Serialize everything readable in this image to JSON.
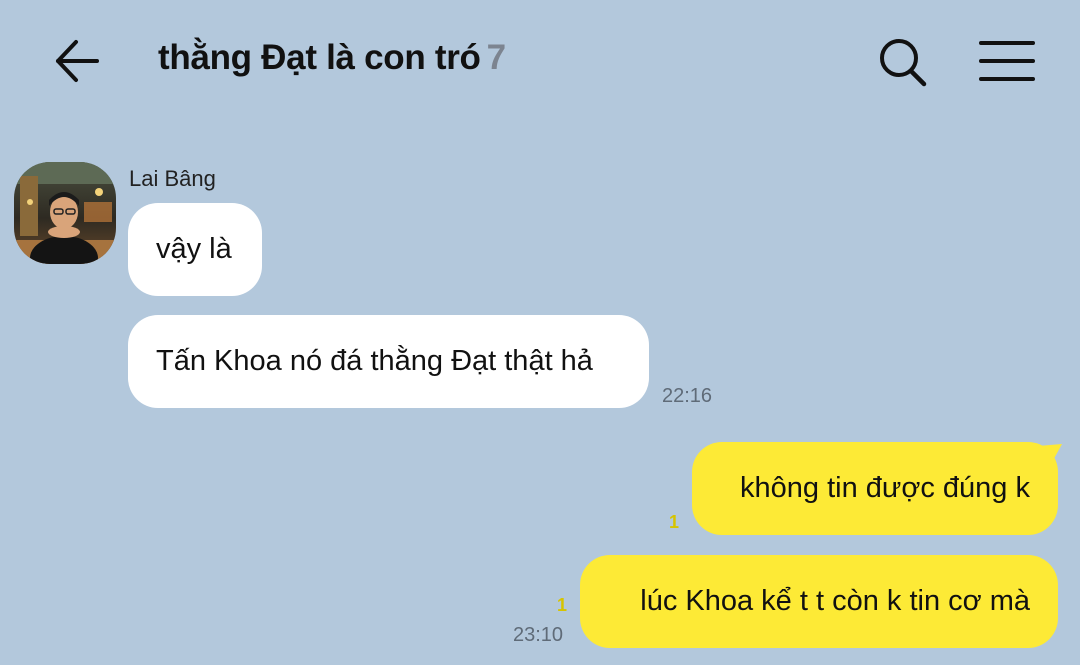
{
  "header": {
    "title": "thằng Đạt là con tró",
    "member_count": "7",
    "icons": {
      "back": "arrow-left-icon",
      "search": "search-icon",
      "menu": "hamburger-menu-icon"
    }
  },
  "colors": {
    "background": "#b3c8dc",
    "incoming_bubble": "#ffffff",
    "outgoing_bubble": "#fdea36",
    "unread_count": "#d6c400",
    "timestamp": "#5f6b78"
  },
  "messages": {
    "incoming": {
      "sender": "Lai Bâng",
      "items": [
        {
          "text": "vậy là"
        },
        {
          "text": "Tấn Khoa nó đá thằng Đạt thật hả",
          "time": "22:16"
        }
      ]
    },
    "outgoing": {
      "items": [
        {
          "text": "không tin được đúng k",
          "unread": "1"
        },
        {
          "text": "lúc Khoa kể t t còn k tin cơ mà",
          "unread": "1",
          "time": "23:10"
        }
      ]
    }
  }
}
